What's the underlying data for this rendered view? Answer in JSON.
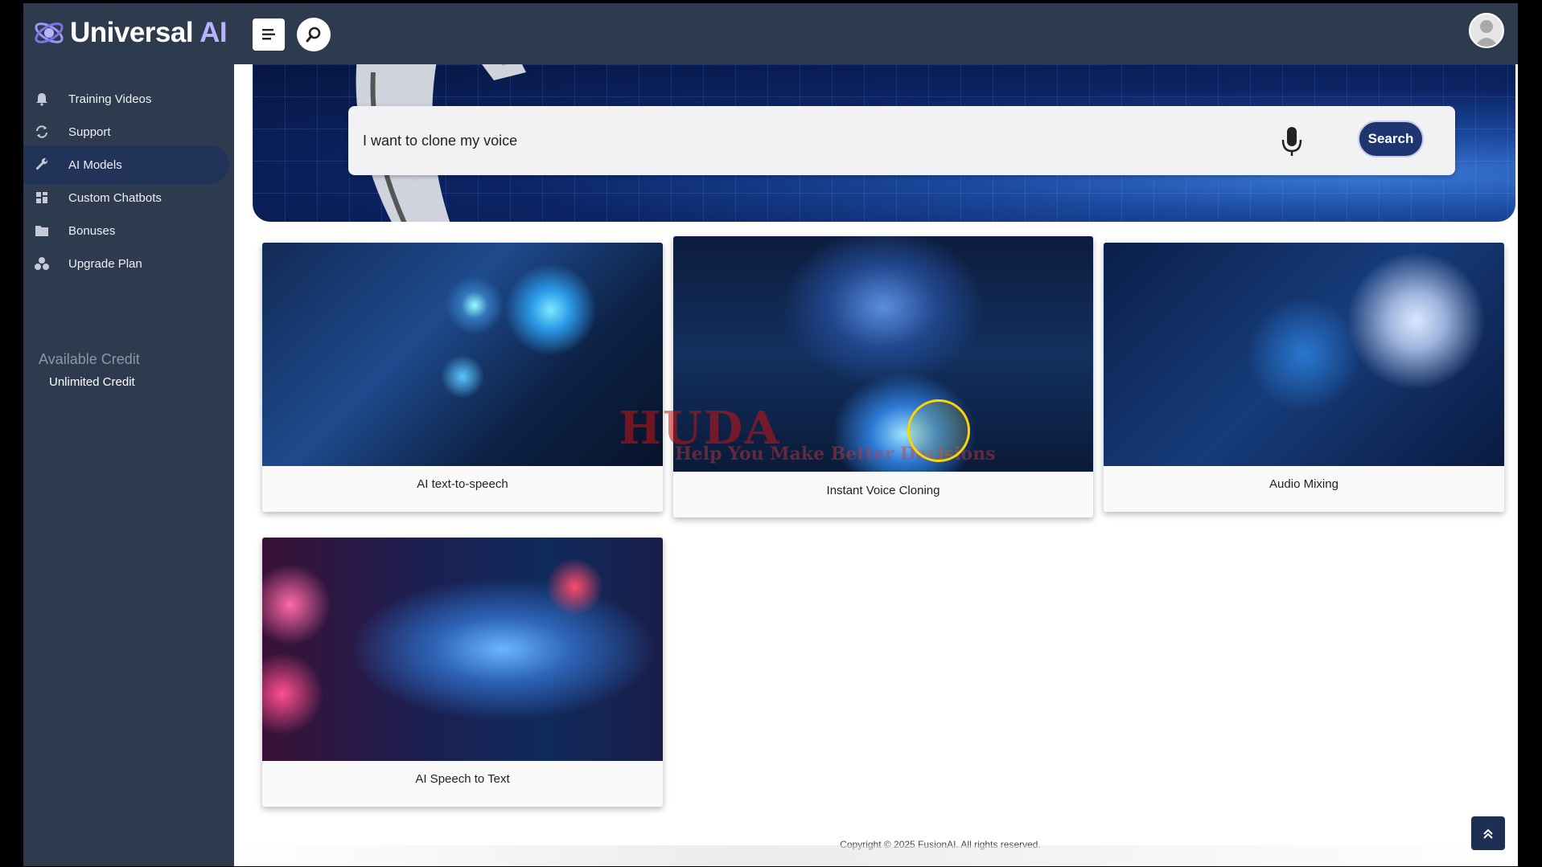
{
  "brand": {
    "name": "Universal",
    "suffix": "AI",
    "accent": "#b8b2ff"
  },
  "topbar": {
    "menu_icon": "menu-lines-icon",
    "search_icon": "search-icon",
    "avatar_icon": "user-avatar-icon"
  },
  "sidebar": {
    "items": [
      {
        "label": "Training Videos",
        "icon": "bell-icon",
        "active": false
      },
      {
        "label": "Support",
        "icon": "refresh-icon",
        "active": false
      },
      {
        "label": "AI Models",
        "icon": "wrench-icon",
        "active": true
      },
      {
        "label": "Custom Chatbots",
        "icon": "grid-icon",
        "active": false
      },
      {
        "label": "Bonuses",
        "icon": "folder-icon",
        "active": false
      },
      {
        "label": "Upgrade Plan",
        "icon": "boxes-icon",
        "active": false
      }
    ],
    "credit_title": "Available Credit",
    "credit_value": "Unlimited Credit"
  },
  "hero": {
    "search_value": "I want to clone my voice",
    "search_button": "Search",
    "mic_icon": "microphone-icon"
  },
  "cards": [
    {
      "label": "AI text-to-speech"
    },
    {
      "label": "Instant Voice Cloning"
    },
    {
      "label": "Audio Mixing"
    },
    {
      "label": "AI Speech to Text"
    }
  ],
  "watermark": {
    "title": "HUDA",
    "subtitle": "Help You Make Better Decisions"
  },
  "footer": {
    "text": "Copyright © 2025 FusionAI. All rights reserved."
  },
  "colors": {
    "sidebar_bg": "#2e3a4e",
    "active_bg": "#22335a",
    "search_button_bg": "#1f3570"
  }
}
